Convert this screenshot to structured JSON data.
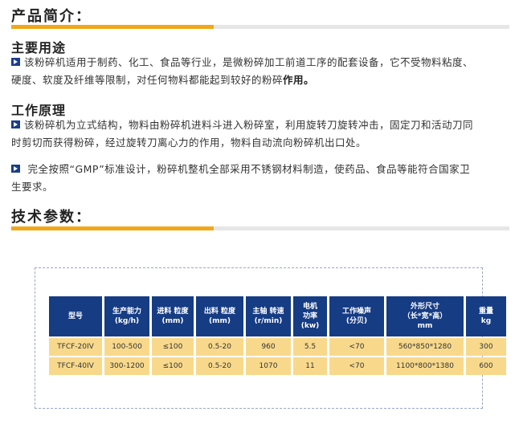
{
  "intro": {
    "heading": "产品简介：",
    "usage_title": "主要用途",
    "usage_text_1": "该粉碎机适用于制药、化工、食品等行业，是微粉碎加工前道工序的配套设备，它不受物料粘度、",
    "usage_text_2": "硬度、软度及纤维等限制，对任何物料都能起到较好的粉碎",
    "usage_text_bold": "作用。",
    "principle_title": "工作原理",
    "principle_text_1": "该粉碎机为立式结构，物料由粉碎机进料斗进入粉碎室，利用旋转刀旋转冲击，固定刀和活动刀同",
    "principle_text_2": "时剪切而获得粉碎，经过旋转刀离心力的作用，物料自动流向粉碎机出口处。",
    "gmp_text_1": "完全按照“GMP”标准设计，粉碎机整机全部采用不锈钢材料制造，使药品、食品等能符合国家卫",
    "gmp_text_2": "生要求。"
  },
  "specs": {
    "heading": "技术参数：",
    "headers": [
      [
        "型号"
      ],
      [
        "生产能力",
        "(kg/h)"
      ],
      [
        "进料 粒度",
        "(mm)"
      ],
      [
        "出料 粒度",
        "(mm)"
      ],
      [
        "主轴 转速",
        "(r/min)"
      ],
      [
        "电机",
        "功率",
        "(kw)"
      ],
      [
        "工作噪声",
        "(分贝)"
      ],
      [
        "外形尺寸",
        "（长*宽*高）",
        "mm"
      ],
      [
        "重量",
        "kg"
      ]
    ],
    "rows": [
      [
        "TFCF-20IV",
        "100-500",
        "≤100",
        "0.5-20",
        "960",
        "5.5",
        "<70",
        "560*850*1280",
        "300"
      ],
      [
        "TFCF-40IV",
        "300-1200",
        "≤100",
        "0.5-20",
        "1070",
        "11",
        "<70",
        "1100*800*1380",
        "600"
      ]
    ]
  },
  "colors": {
    "accent": "#f0a81a",
    "header_bg": "#163c84",
    "cell_bg": "#f8d98c",
    "bullet": "#1a3d8c"
  }
}
